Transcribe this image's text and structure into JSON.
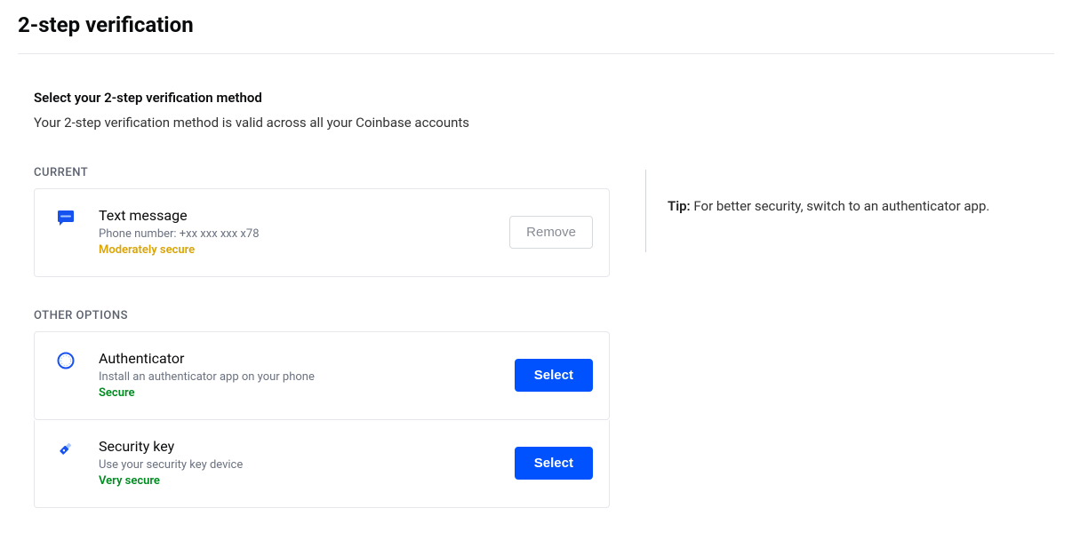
{
  "pageTitle": "2-step verification",
  "instruction": {
    "title": "Select your 2-step verification method",
    "subtitle": "Your 2-step verification method is valid across all your Coinbase accounts"
  },
  "sections": {
    "currentLabel": "CURRENT",
    "otherLabel": "OTHER OPTIONS"
  },
  "current": {
    "title": "Text message",
    "desc": "Phone number: +xx xxx xxx x78",
    "security": "Moderately secure",
    "action": "Remove"
  },
  "options": [
    {
      "title": "Authenticator",
      "desc": "Install an authenticator app on your phone",
      "security": "Secure",
      "action": "Select"
    },
    {
      "title": "Security key",
      "desc": "Use your security key device",
      "security": "Very secure",
      "action": "Select"
    }
  ],
  "tip": {
    "label": "Tip:",
    "text": " For better security, switch to an authenticator app."
  }
}
